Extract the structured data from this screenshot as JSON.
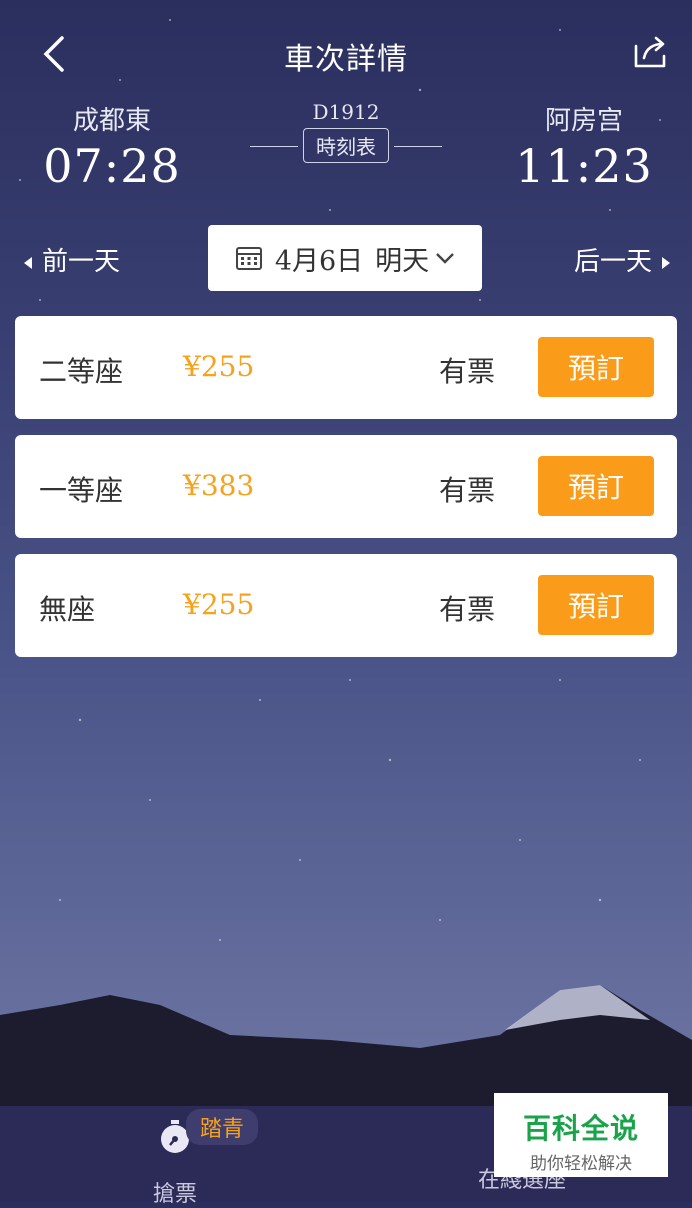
{
  "header": {
    "title": "車次詳情"
  },
  "train": {
    "from_station": "成都東",
    "depart_time": "07:28",
    "train_no": "D1912",
    "timetable_label": "時刻表",
    "to_station": "阿房宫",
    "arrive_time": "11:23"
  },
  "date_nav": {
    "prev_label": "前一天",
    "date": "4月6日",
    "day_label": "明天",
    "next_label": "后一天"
  },
  "seats": [
    {
      "name": "二等座",
      "price": "¥255",
      "availability": "有票",
      "book_label": "預訂"
    },
    {
      "name": "一等座",
      "price": "¥383",
      "availability": "有票",
      "book_label": "預訂"
    },
    {
      "name": "無座",
      "price": "¥255",
      "availability": "有票",
      "book_label": "預訂"
    }
  ],
  "tabbar": {
    "grab_label": "搶票",
    "grab_badge": "踏青",
    "online_label": "在綫選座"
  },
  "watermark": {
    "main": "百科全说",
    "sub": "助你轻松解决"
  },
  "colors": {
    "accent": "#fb9b1a",
    "price": "#f7a21b",
    "tabbar": "#2c2a57"
  },
  "icons": [
    "back-icon",
    "share-icon",
    "calendar-icon",
    "chevron-down-icon",
    "triangle-left-icon",
    "triangle-right-icon",
    "stopwatch-icon"
  ]
}
